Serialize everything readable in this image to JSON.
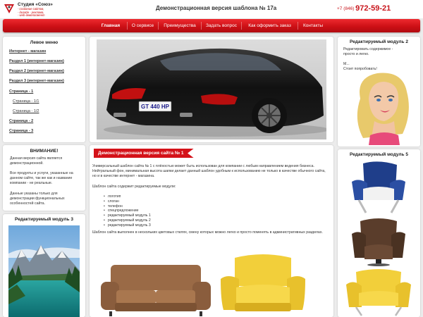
{
  "header": {
    "logo": {
      "title": "Студия «Союз»",
      "lines": [
        "- создание сайтов,",
        "- дизайн - реклама,",
        "- web-девелопмент"
      ]
    },
    "site_title": "Демонстрационная версия шаблона № 17а",
    "phone_prefix": "+7 (846)",
    "phone_number": "972-59-21",
    "accent_color": "#cd1016"
  },
  "nav": {
    "items": [
      {
        "label": "Главная",
        "active": true
      },
      {
        "label": "О сервисе"
      },
      {
        "label": "Преимущества"
      },
      {
        "label": "Задать вопрос"
      },
      {
        "label": "Как оформить заказ"
      },
      {
        "label": "Контакты"
      }
    ]
  },
  "left_menu": {
    "title": "Левое меню",
    "items": [
      {
        "label": "Интернет - магазин",
        "level": 1
      },
      {
        "label": "Раздел 1 (интернет-магазин)",
        "level": 1
      },
      {
        "label": "Раздел 2 (интернет-магазин)",
        "level": 1
      },
      {
        "label": "Раздел 3 (интернет-магазин)",
        "level": 1
      },
      {
        "label": "Страница - 1",
        "level": 1
      },
      {
        "label": "Страница - 1/1",
        "level": 2
      },
      {
        "label": "Страница - 1/2",
        "level": 2
      },
      {
        "label": "Страница - 2",
        "level": 1
      },
      {
        "label": "Страница - 3",
        "level": 1
      }
    ]
  },
  "notice": {
    "title": "ВНИМАНИЕ!",
    "paragraphs": [
      "Данная версия сайта является демонстрационной.",
      "Все продукты и услуги, указанные на данном сайте, так же как и название компании - не реальные.",
      "Данные указаны только для демонстрации функциональных особенностей сайта."
    ]
  },
  "module3": {
    "title": "Редактируемый модуль 3"
  },
  "content": {
    "banner": "Демонстрационная версия сайта № 1",
    "intro": "Универсальный шаблон сайта № 1 с плёхостью может быть использован для компании с любым направлением ведения бизнеса. Нейтральный фон, минимальная высота шапки делает данный шаблон удобным к использованию не только в качестве обычного сайта, но и в качестве интернет - магазина.",
    "list_title": "Шаблон сайта содержит редактируемые модули:",
    "list": [
      "логотип",
      "слоган",
      "телефон",
      "спецпредложение",
      "редактируемый модуль 1",
      "редактируемый модуль 2",
      "редактируемый модуль 3"
    ],
    "footer_text": "Шаблон сайта выполнен в нескольких цветовых стилях, смену которых можно легко и просто поменять в административных разделах."
  },
  "car_plate": "GT 440 HP",
  "module2": {
    "title": "Редактируемый модуль 2",
    "lines": [
      "Редактировать содержимое -",
      "просто и легко."
    ],
    "mid": "М...",
    "cta": "Стоит попробовать!"
  },
  "module5": {
    "title": "Редактируемый модуль 5"
  }
}
